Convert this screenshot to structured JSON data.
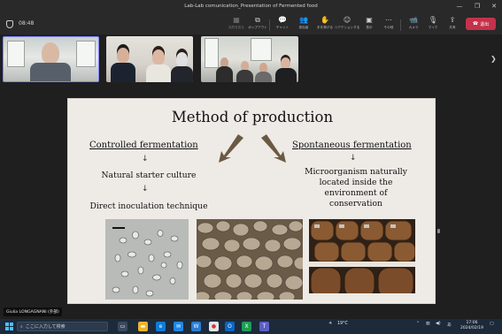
{
  "window": {
    "title": "Lab-Lab comunication_Presentation of Fermented food",
    "controls": [
      "—",
      "❐",
      "✕"
    ]
  },
  "meeting": {
    "elapsed": "08:48",
    "toolbar": [
      {
        "key": "call-quality",
        "icon": "▦",
        "label": "品質を見る",
        "dim": true
      },
      {
        "key": "popout",
        "icon": "⧉",
        "label": "ポップアウト",
        "dim": false
      },
      {
        "key": "chat",
        "icon": "💬",
        "label": "チャット",
        "dim": false
      },
      {
        "key": "people",
        "icon": "👥",
        "label": "参加者",
        "dim": false
      },
      {
        "key": "raise-hand",
        "icon": "✋",
        "label": "手を挙げる",
        "dim": false
      },
      {
        "key": "react",
        "icon": "☺",
        "label": "リアクションする",
        "dim": false
      },
      {
        "key": "view",
        "icon": "▣",
        "label": "表示",
        "dim": false
      },
      {
        "key": "more",
        "icon": "⋯",
        "label": "その他",
        "dim": false
      },
      {
        "key": "camera",
        "icon": "📹",
        "label": "カメラ",
        "dim": false
      },
      {
        "key": "mic",
        "icon": "🎙",
        "label": "マイク",
        "dim": false
      },
      {
        "key": "share",
        "icon": "⇪",
        "label": "共有",
        "dim": false
      }
    ],
    "leave_label": "退出",
    "presenter_name": "Giulia LONGAGNANI (外部)"
  },
  "slide": {
    "title": "Method of production",
    "left_heading": "Controlled fermentation",
    "left_step1": "Natural starter culture",
    "left_step2": "Direct inoculation technique",
    "right_heading": "Spontaneous fermentation",
    "right_text_line1": "Microorganism naturally",
    "right_text_line2": "located inside the",
    "right_text_line3": "environment of",
    "right_text_line4": "conservation",
    "arrow_glyph": "↓"
  },
  "taskbar": {
    "search_placeholder": "ここに入力して検索",
    "weather": "19°C",
    "ime": "あ",
    "time": "17:06",
    "date": "2024/02/19"
  }
}
